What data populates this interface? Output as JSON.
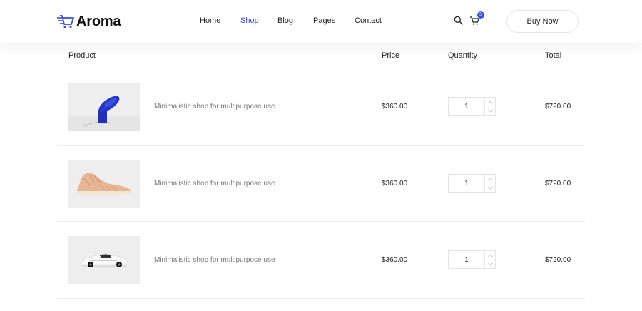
{
  "brand": {
    "name": "Aroma",
    "accent": "#384aeb"
  },
  "nav": {
    "items": [
      {
        "label": "Home"
      },
      {
        "label": "Shop",
        "active": true
      },
      {
        "label": "Blog"
      },
      {
        "label": "Pages"
      },
      {
        "label": "Contact"
      }
    ]
  },
  "header_actions": {
    "search_icon": "search-icon",
    "cart_icon": "cart-icon",
    "cart_count": "3",
    "buy_label": "Buy Now"
  },
  "table": {
    "columns": [
      "Product",
      "Price",
      "Quantity",
      "Total"
    ],
    "rows": [
      {
        "image": "blue-lamp-image",
        "name": "Minimalistic shop for multipurpose use",
        "price": "$360.00",
        "quantity": "1",
        "total": "$720.00"
      },
      {
        "image": "sneaker-image",
        "name": "Minimalistic shop for multipurpose use",
        "price": "$360.00",
        "quantity": "1",
        "total": "$720.00"
      },
      {
        "image": "toy-car-image",
        "name": "Minimalistic shop for multipurpose use",
        "price": "$360.00",
        "quantity": "1",
        "total": "$720.00"
      }
    ]
  }
}
